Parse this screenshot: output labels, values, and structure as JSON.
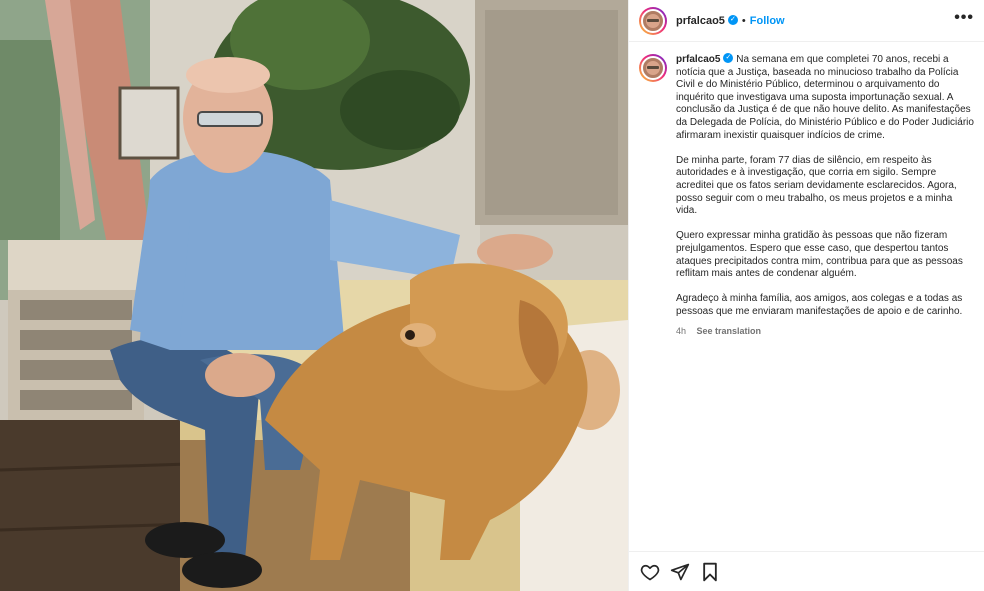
{
  "post": {
    "username": "prfalcao5",
    "verified_glyph": "✓",
    "separator": "•",
    "follow_label": "Follow",
    "more_label": "•••",
    "caption_paragraphs": [
      "Na semana em que completei 70 anos, recebi a notícia que a Justiça, baseada no minucioso trabalho da Polícia Civil e do Ministério Público, determinou o arquivamento do inquérito que investigava uma suposta importunação sexual. A conclusão da Justiça é de que não houve delito. As manifestações da Delegada de Polícia, do Ministério Público e do Poder Judiciário afirmaram inexistir quaisquer indícios de crime.",
      "De minha parte, foram 77 dias de silêncio, em respeito às autoridades e à investigação, que corria em sigilo. Sempre acreditei que os fatos seriam devidamente esclarecidos. Agora, posso seguir com o meu trabalho, os meus projetos e a minha vida.",
      "Quero expressar minha gratidão às pessoas que não fizeram prejulgamentos. Espero que esse caso, que despertou tantos ataques precipitados contra mim, contribua para que as pessoas reflitam mais antes de condenar alguém.",
      "Agradeço à minha família, aos amigos, aos colegas e a todas as pessoas que me enviaram manifestações de apoio e de carinho."
    ],
    "timestamp": "4h",
    "see_translation_label": "See translation"
  },
  "actions": {
    "like_icon": "heart-icon",
    "share_icon": "send-icon",
    "save_icon": "bookmark-icon"
  },
  "colors": {
    "accent": "#0095f6",
    "text": "#262626",
    "muted": "#737373",
    "divider": "#efefef"
  }
}
